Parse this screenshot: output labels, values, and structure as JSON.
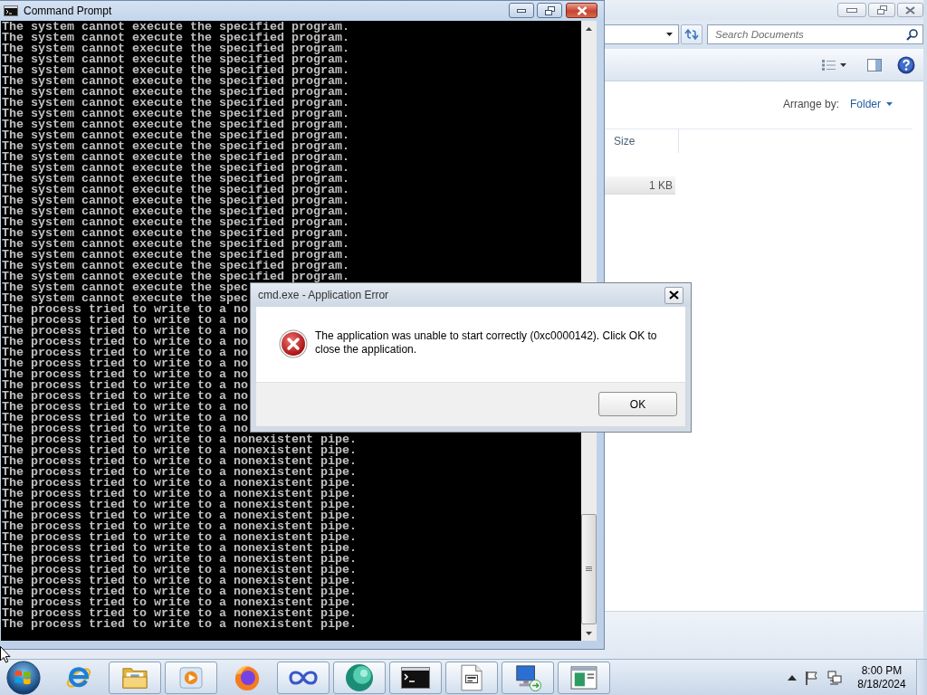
{
  "console_window": {
    "title": "Command Prompt",
    "lines": [
      "The system cannot execute the specified program.",
      "The system cannot execute the specified program.",
      "The system cannot execute the specified program.",
      "The system cannot execute the specified program.",
      "The system cannot execute the specified program.",
      "The system cannot execute the specified program.",
      "The system cannot execute the specified program.",
      "The system cannot execute the specified program.",
      "The system cannot execute the specified program.",
      "The system cannot execute the specified program.",
      "The system cannot execute the specified program.",
      "The system cannot execute the specified program.",
      "The system cannot execute the specified program.",
      "The system cannot execute the specified program.",
      "The system cannot execute the specified program.",
      "The system cannot execute the specified program.",
      "The system cannot execute the specified program.",
      "The system cannot execute the specified program.",
      "The system cannot execute the specified program.",
      "The system cannot execute the specified program.",
      "The system cannot execute the specified program.",
      "The system cannot execute the specified program.",
      "The system cannot execute the specified program.",
      "The system cannot execute the specified program.",
      "The system cannot execute the spec",
      "The system cannot execute the spec",
      "The process tried to write to a no",
      "The process tried to write to a no",
      "The process tried to write to a no",
      "The process tried to write to a no",
      "The process tried to write to a no",
      "The process tried to write to a no",
      "The process tried to write to a no",
      "The process tried to write to a no",
      "The process tried to write to a no",
      "The process tried to write to a no",
      "The process tried to write to a no",
      "The process tried to write to a no",
      "The process tried to write to a nonexistent pipe.",
      "The process tried to write to a nonexistent pipe.",
      "The process tried to write to a nonexistent pipe.",
      "The process tried to write to a nonexistent pipe.",
      "The process tried to write to a nonexistent pipe.",
      "The process tried to write to a nonexistent pipe.",
      "The process tried to write to a nonexistent pipe.",
      "The process tried to write to a nonexistent pipe.",
      "The process tried to write to a nonexistent pipe.",
      "The process tried to write to a nonexistent pipe.",
      "The process tried to write to a nonexistent pipe.",
      "The process tried to write to a nonexistent pipe.",
      "The process tried to write to a nonexistent pipe.",
      "The process tried to write to a nonexistent pipe.",
      "The process tried to write to a nonexistent pipe.",
      "The process tried to write to a nonexistent pipe.",
      "The process tried to write to a nonexistent pipe.",
      "The process tried to write to a nonexistent pipe."
    ]
  },
  "explorer_window": {
    "search": {
      "placeholder": "Search Documents"
    },
    "arrange_by": {
      "label": "Arrange by:",
      "value": "Folder"
    },
    "columns": [
      "Size"
    ],
    "rows": [
      [
        "1 KB"
      ]
    ]
  },
  "dialog": {
    "title": "cmd.exe - Application Error",
    "message": "The application was unable to start correctly (0xc0000142). Click OK to close the application.",
    "buttons": [
      "OK"
    ]
  },
  "taskbar": {
    "buttons": [
      {
        "running": false
      },
      {
        "running": true
      },
      {
        "running": true
      },
      {
        "running": false
      },
      {
        "running": true
      },
      {
        "running": true
      },
      {
        "running": true
      },
      {
        "running": true
      },
      {
        "running": true
      },
      {
        "running": true
      }
    ],
    "clock": {
      "time": "8:00 PM",
      "date": "8/18/2024"
    }
  }
}
